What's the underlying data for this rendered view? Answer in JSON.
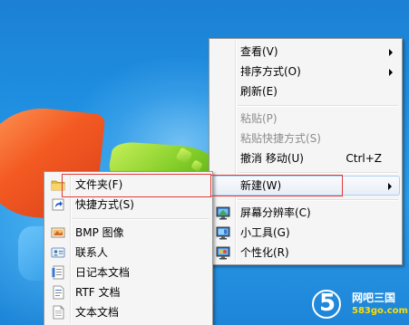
{
  "main_menu": {
    "items": [
      {
        "label": "查看(V)",
        "submenu": true,
        "disabled": false,
        "icon": null
      },
      {
        "label": "排序方式(O)",
        "submenu": true,
        "disabled": false,
        "icon": null
      },
      {
        "label": "刷新(E)",
        "submenu": false,
        "disabled": false,
        "icon": null
      },
      {
        "label": "粘贴(P)",
        "submenu": false,
        "disabled": true,
        "icon": null
      },
      {
        "label": "粘贴快捷方式(S)",
        "submenu": false,
        "disabled": true,
        "icon": null
      },
      {
        "label": "撤消 移动(U)",
        "shortcut": "Ctrl+Z",
        "submenu": false,
        "disabled": false,
        "icon": null
      },
      {
        "label": "新建(W)",
        "submenu": true,
        "disabled": false,
        "highlighted": true,
        "icon": null
      },
      {
        "label": "屏幕分辨率(C)",
        "submenu": false,
        "disabled": false,
        "icon": "screen-resolution-icon"
      },
      {
        "label": "小工具(G)",
        "submenu": false,
        "disabled": false,
        "icon": "gadgets-icon"
      },
      {
        "label": "个性化(R)",
        "submenu": false,
        "disabled": false,
        "icon": "personalize-icon"
      }
    ]
  },
  "sub_menu": {
    "items": [
      {
        "label": "文件夹(F)",
        "icon": "folder-icon",
        "highlighted": true
      },
      {
        "label": "快捷方式(S)",
        "icon": "shortcut-icon"
      },
      {
        "label": "BMP 图像",
        "icon": "bmp-image-icon"
      },
      {
        "label": "联系人",
        "icon": "contact-icon"
      },
      {
        "label": "日记本文档",
        "icon": "journal-document-icon"
      },
      {
        "label": "RTF 文档",
        "icon": "rtf-document-icon"
      },
      {
        "label": "文本文档",
        "icon": "text-document-icon"
      }
    ]
  },
  "watermark": {
    "digit": "5",
    "title": "网吧三国",
    "url": "583go.com"
  },
  "colors": {
    "highlight_box": "#e23a3a",
    "desktop_blue": "#1f8ee0",
    "watermark_url": "#ffde00"
  }
}
